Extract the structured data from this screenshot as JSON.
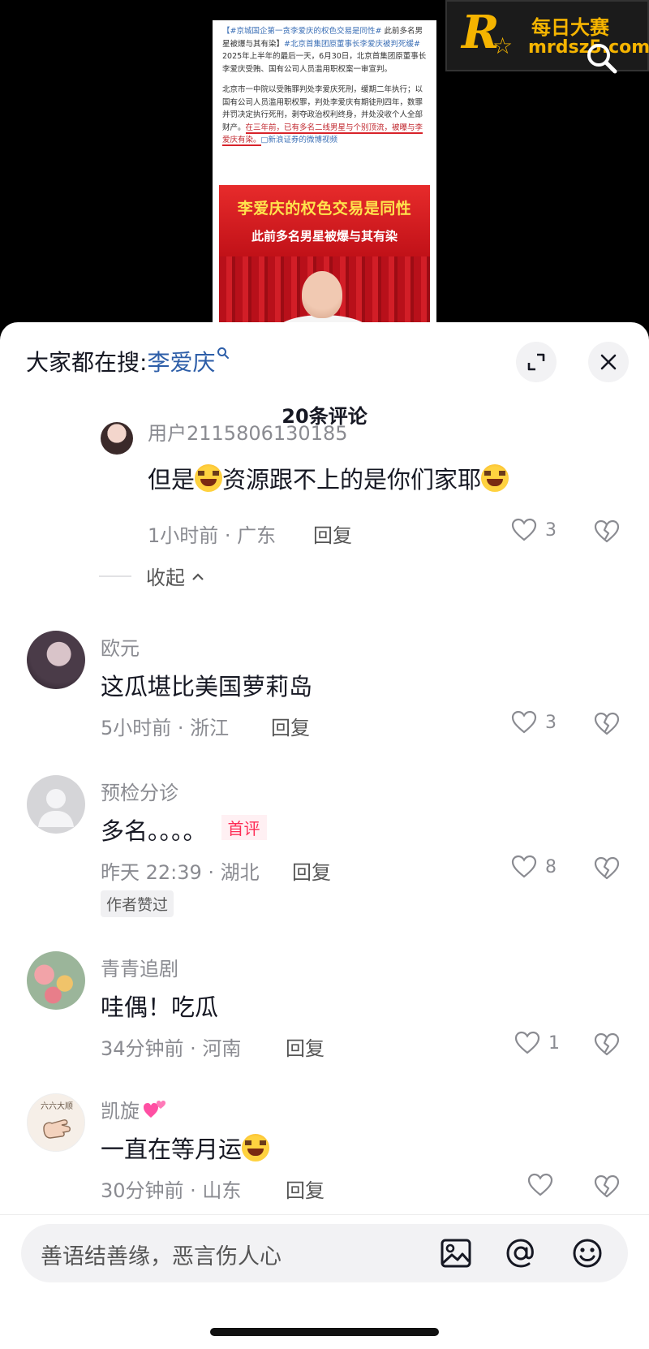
{
  "article": {
    "tag1": "【#京城国企第一贪李爱庆的权色交易是同性#",
    "lead": " 此前多名男星被爆与其有染】",
    "tag2": "#北京首集团原董事长李爱庆被判死缓#",
    "body1": " 2025年上半年的最后一天，6月30日，北京首集团原董事长李爱庆受贿、国有公司人员滥用职权案一审宣判。",
    "body2": "北京市一中院以受贿罪判处李爱庆死刑，缓期二年执行；以国有公司人员滥用职权罪，判处李爱庆有期徒刑四年，数罪并罚决定执行死刑，剥夺政治权利终身，并处没收个人全部财产。",
    "highlight": "在三年前，已有多名二线男星与个别顶流，被曝与李爱庆有染。",
    "source": "□新浪证券的微博视频",
    "image_headline1": "李爱庆的权色交易是同性",
    "image_headline2": "此前多名男星被爆与其有染"
  },
  "brand": {
    "name": "每日大赛",
    "domain": "mrdsz5.com",
    "mark": "R",
    "accent": "#f5b400"
  },
  "sheet": {
    "search_prefix": "大家都在搜:",
    "search_keyword": "李爱庆",
    "comment_count": "20条评论",
    "expand_icon": "expand-icon",
    "close_icon": "close-icon"
  },
  "comments": [
    {
      "name": "用户2115806130185",
      "text_part1": "但是",
      "text_part2": "资源跟不上的是你们家耶",
      "meta": "1小时前 · 广东",
      "reply": "回复",
      "likes": "3",
      "fold": "收起"
    },
    {
      "name": "欧元",
      "text": "这瓜堪比美国萝莉岛",
      "meta": "5小时前 · 浙江",
      "reply": "回复",
      "likes": "3"
    },
    {
      "name": "预检分诊",
      "text": "多名。。。。",
      "badge": "首评",
      "meta": "昨天 22:39 · 湖北",
      "reply": "回复",
      "likes": "8",
      "author_liked": "作者赞过"
    },
    {
      "name": "青青追剧",
      "text": "哇偶！吃瓜",
      "meta": "34分钟前 · 河南",
      "reply": "回复",
      "likes": "1"
    },
    {
      "name": "凯旋",
      "text": "一直在等月运",
      "meta": "30分钟前 · 山东",
      "reply": "回复",
      "likes": "",
      "avatar_text": "六六大顺"
    }
  ],
  "input": {
    "placeholder": "善语结善缘，恶言伤人心",
    "icons": [
      "image-icon",
      "at-icon",
      "emoji-icon"
    ]
  },
  "colors": {
    "accent_pink": "#fe2c55",
    "link_blue": "#2d5ea8",
    "meta_gray": "#8a8b91"
  }
}
